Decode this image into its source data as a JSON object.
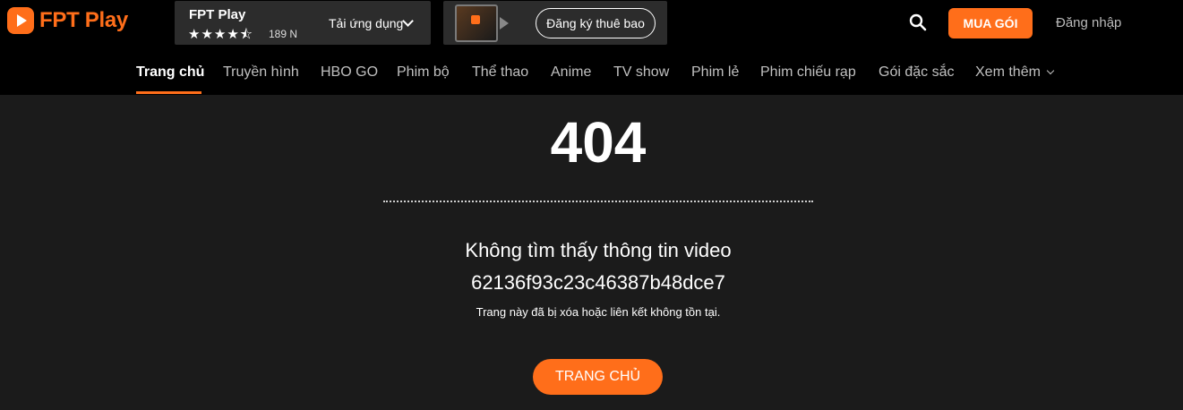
{
  "brand": {
    "logo_text": "FPT Play",
    "accent": "#ff6e1a"
  },
  "app_banner": {
    "app_name": "FPT Play",
    "stars": "★★★★⯪",
    "rating": 4.5,
    "rating_count": "189 N",
    "download_label": "Tải ứng dụng"
  },
  "promo": {
    "image_icon": "fpt-play-box-icon",
    "subscribe_label": "Đăng ký thuê bao"
  },
  "header": {
    "buy_label": "MUA GÓI",
    "login_label": "Đăng nhập",
    "search_icon": "search-icon"
  },
  "nav": {
    "items": [
      {
        "label": "Trang chủ"
      },
      {
        "label": "Truyền hình"
      },
      {
        "label": "HBO GO"
      },
      {
        "label": "Phim bộ"
      },
      {
        "label": "Thể thao"
      },
      {
        "label": "Anime"
      },
      {
        "label": "TV show"
      },
      {
        "label": "Phim lẻ"
      },
      {
        "label": "Phim chiếu rạp"
      },
      {
        "label": "Gói đặc sắc"
      },
      {
        "label": "Xem thêm"
      }
    ]
  },
  "error": {
    "code": "404",
    "title": "Không tìm thấy thông tin video",
    "video_id": "62136f93c23c46387b48dce7",
    "description": "Trang này đã bị xóa hoặc liên kết không tồn tại.",
    "home_button": "TRANG CHỦ"
  }
}
